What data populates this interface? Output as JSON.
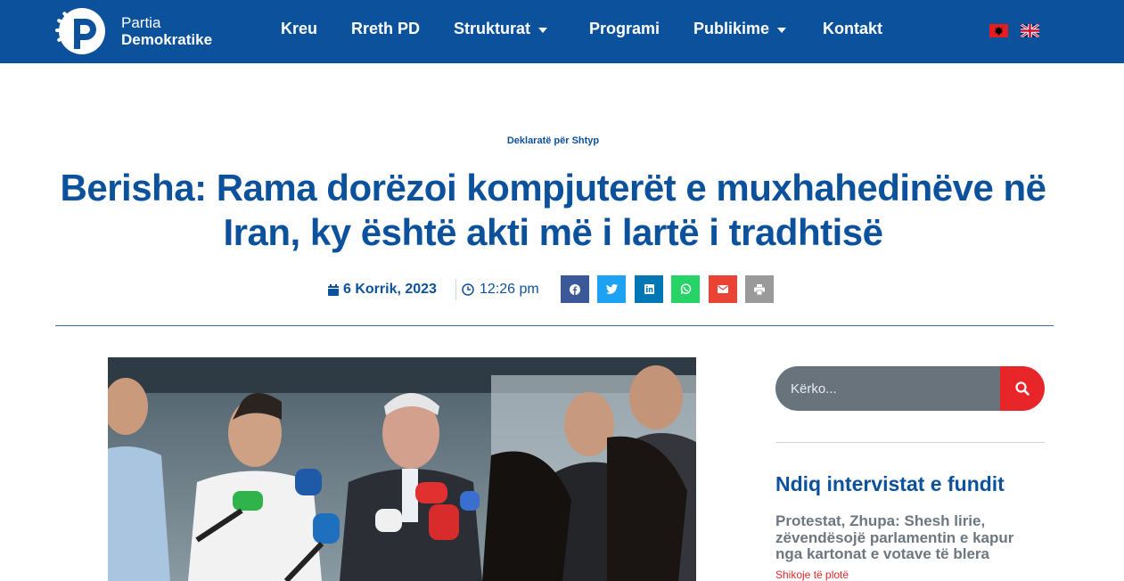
{
  "header": {
    "logo": {
      "line1": "Partia",
      "line2": "Demokratike"
    },
    "nav": [
      {
        "label": "Kreu",
        "has_dropdown": false
      },
      {
        "label": "Rreth PD",
        "has_dropdown": false
      },
      {
        "label": "Strukturat",
        "has_dropdown": true
      },
      {
        "label": "Programi",
        "has_dropdown": false
      },
      {
        "label": "Publikime",
        "has_dropdown": true
      },
      {
        "label": "Kontakt",
        "has_dropdown": false
      }
    ],
    "languages": [
      "albanian-flag-icon",
      "uk-flag-icon"
    ]
  },
  "article": {
    "category": "Deklaratë për Shtyp",
    "title": "Berisha: Rama dorëzoi kompjuterët e muxhahedinëve në Iran, ky është akti më i lartë i tradhtisë",
    "date": "6 Korrik, 2023",
    "time": "12:26 pm",
    "share_buttons": [
      {
        "name": "facebook",
        "color": "#3b5998"
      },
      {
        "name": "twitter",
        "color": "#1da1f2"
      },
      {
        "name": "linkedin",
        "color": "#0077b5"
      },
      {
        "name": "whatsapp",
        "color": "#25d366"
      },
      {
        "name": "email",
        "color": "#ea4335"
      },
      {
        "name": "print",
        "color": "#9a9a9a"
      }
    ]
  },
  "sidebar": {
    "search": {
      "placeholder": "Kërko..."
    },
    "section_title": "Ndiq intervistat e fundit",
    "latest": {
      "title": "Protestat, Zhupa: Shesh lirie, zëvendësojë parlamentin e kapur nga kartonat e votave të blera",
      "more_label": "Shikoje të plotë"
    }
  },
  "colors": {
    "brand": "#0c519c",
    "accent": "#e8262a",
    "search_bg": "#69737c"
  }
}
